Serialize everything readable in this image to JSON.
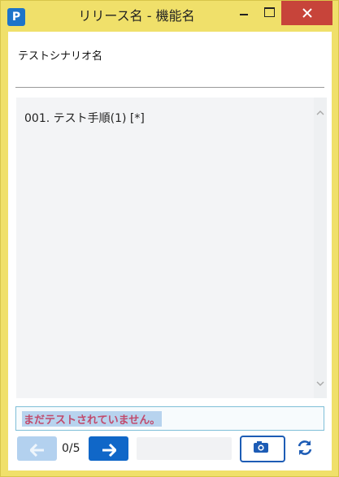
{
  "window": {
    "title": "リリース名 - 機能名",
    "icon_letter": "P",
    "controls": [
      "minimize-icon",
      "maximize-icon",
      "close-icon"
    ]
  },
  "scenario": {
    "name": "テストシナリオ名"
  },
  "steps": {
    "items": [
      {
        "label": "001. テスト手順(1) [*]"
      }
    ]
  },
  "status": {
    "message": "まだテストされていません。"
  },
  "navigation": {
    "prev_icon": "arrow-left-icon",
    "next_icon": "arrow-right-icon",
    "page_indicator": "0/5"
  },
  "actions": {
    "camera_icon": "camera-icon",
    "refresh_icon": "refresh-icon"
  },
  "colors": {
    "window_frame": "#f0e06a",
    "close_button": "#c7443a",
    "next_button": "#1067c8",
    "prev_button_disabled": "#b3d1ef",
    "status_text": "#c14a6c",
    "status_highlight": "#b7d3ee"
  }
}
